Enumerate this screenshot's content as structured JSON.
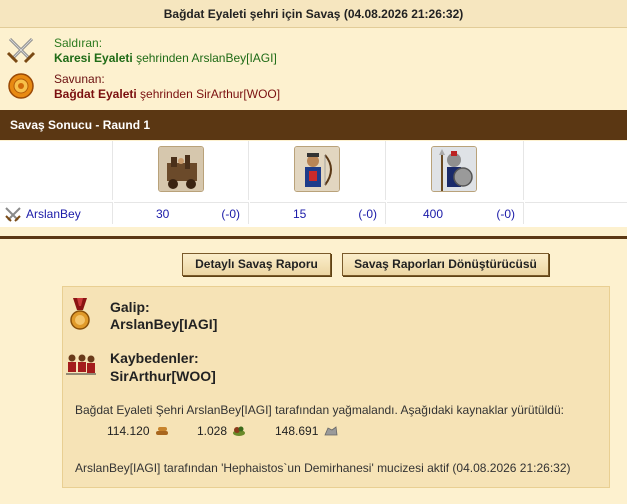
{
  "title": "Bağdat Eyaleti şehri için Savaş (04.08.2026 21:26:32)",
  "attacker": {
    "role": "Saldıran:",
    "city": "Karesi Eyaleti",
    "rest": "şehrinden ArslanBey[IAGI]",
    "icon": "crossed-swords-icon"
  },
  "defender": {
    "role": "Savunan:",
    "city": "Bağdat Eyaleti",
    "rest": "şehrinden SirArthur[WOO]",
    "icon": "shield-icon"
  },
  "result_header": "Savaş Sonucu - Raund 1",
  "battle": {
    "player": "ArslanBey",
    "units": [
      {
        "icon": "siege-unit-icon",
        "count": "30",
        "loss": "(-0)"
      },
      {
        "icon": "archer-unit-icon",
        "count": "15",
        "loss": "(-0)"
      },
      {
        "icon": "spearman-unit-icon",
        "count": "400",
        "loss": "(-0)"
      }
    ]
  },
  "buttons": {
    "detailed_report": "Detaylı Savaş Raporu",
    "converter": "Savaş Raporları Dönüştürücüsü"
  },
  "summary": {
    "winner_label": "Galip:",
    "winner": "ArslanBey[IAGI]",
    "losers_label": "Kaybedenler:",
    "losers": "SirArthur[WOO]",
    "plunder_text": "Bağdat Eyaleti Şehri ArslanBey[IAGI] tarafından yağmalandı. Aşağıdaki kaynaklar yürütüldü:",
    "resources": [
      {
        "amount": "114.120",
        "icon": "wood-icon"
      },
      {
        "amount": "1.028",
        "icon": "food-icon"
      },
      {
        "amount": "148.691",
        "icon": "stone-icon"
      }
    ],
    "wonder_text": "ArslanBey[IAGI] tarafından 'Hephaistos`un Demirhanesi' mucizesi aktif (04.08.2026 21:26:32)"
  }
}
